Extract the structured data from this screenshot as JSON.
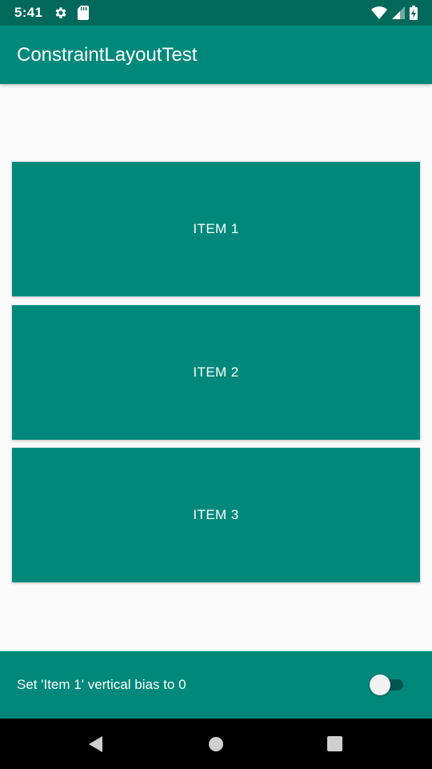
{
  "status_bar": {
    "time": "5:41",
    "left_icons": [
      "gear-icon",
      "sd-card-icon"
    ],
    "right_icons": [
      "wifi-icon",
      "cell-signal-icon",
      "battery-charging-icon"
    ]
  },
  "app_bar": {
    "title": "ConstraintLayoutTest"
  },
  "items": [
    {
      "label": "ITEM 1"
    },
    {
      "label": "ITEM 2"
    },
    {
      "label": "ITEM 3"
    }
  ],
  "control_bar": {
    "label": "Set 'Item 1' vertical bias to 0",
    "switch_on": false
  },
  "nav_bar": {
    "buttons": [
      "back-icon",
      "home-icon",
      "recents-icon"
    ]
  },
  "colors": {
    "primary": "#00897b",
    "primary_dark": "#00695c",
    "background": "#fafafa"
  }
}
